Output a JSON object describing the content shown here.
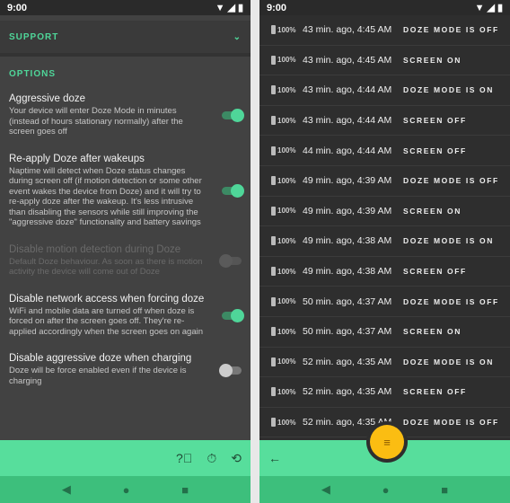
{
  "left": {
    "status_time": "9:00",
    "support_label": "SUPPORT",
    "options_label": "OPTIONS",
    "options": [
      {
        "title": "Aggressive doze",
        "desc": "Your device will enter Doze Mode in minutes (instead of hours stationary normally) after the screen goes off",
        "enabled": true,
        "disabled": false
      },
      {
        "title": "Re-apply Doze after wakeups",
        "desc": "Naptime will detect when Doze status changes during screen off (if motion detection or some other event wakes the device from Doze) and it will try to re-apply doze after the wakeup. It's less intrusive than disabling the sensors while still improving the \"aggressive doze\" functionality and battery savings",
        "enabled": true,
        "disabled": false
      },
      {
        "title": "Disable motion detection during Doze",
        "desc": "Default Doze behaviour. As soon as there is motion activity the device will come out of Doze",
        "enabled": false,
        "disabled": true
      },
      {
        "title": "Disable network access when forcing doze",
        "desc": "WiFi and mobile data are turned off when doze is forced on after the screen goes off. They're re-applied accordingly when the screen goes on again",
        "enabled": true,
        "disabled": false
      },
      {
        "title": "Disable aggressive doze when charging",
        "desc": "Doze will be force enabled even if the device is charging",
        "enabled": false,
        "disabled": false
      }
    ]
  },
  "right": {
    "status_time": "9:00",
    "events": [
      {
        "battery": "100%",
        "time": "43 min. ago, 4:45 AM",
        "event": "DOZE MODE IS OFF"
      },
      {
        "battery": "100%",
        "time": "43 min. ago, 4:45 AM",
        "event": "SCREEN ON"
      },
      {
        "battery": "100%",
        "time": "43 min. ago, 4:44 AM",
        "event": "DOZE MODE IS ON"
      },
      {
        "battery": "100%",
        "time": "43 min. ago, 4:44 AM",
        "event": "SCREEN OFF"
      },
      {
        "battery": "100%",
        "time": "44 min. ago, 4:44 AM",
        "event": "SCREEN OFF"
      },
      {
        "battery": "100%",
        "time": "49 min. ago, 4:39 AM",
        "event": "DOZE MODE IS OFF"
      },
      {
        "battery": "100%",
        "time": "49 min. ago, 4:39 AM",
        "event": "SCREEN ON"
      },
      {
        "battery": "100%",
        "time": "49 min. ago, 4:38 AM",
        "event": "DOZE MODE IS ON"
      },
      {
        "battery": "100%",
        "time": "49 min. ago, 4:38 AM",
        "event": "SCREEN OFF"
      },
      {
        "battery": "100%",
        "time": "50 min. ago, 4:37 AM",
        "event": "DOZE MODE IS OFF"
      },
      {
        "battery": "100%",
        "time": "50 min. ago, 4:37 AM",
        "event": "SCREEN ON"
      },
      {
        "battery": "100%",
        "time": "52 min. ago, 4:35 AM",
        "event": "DOZE MODE IS ON"
      },
      {
        "battery": "100%",
        "time": "52 min. ago, 4:35 AM",
        "event": "SCREEN OFF"
      },
      {
        "battery": "100%",
        "time": "52 min. ago, 4:35 AM",
        "event": "DOZE MODE IS OFF"
      }
    ]
  },
  "colors": {
    "accent": "#4fd699",
    "bar": "#57de9c",
    "fab": "#fbbd12"
  }
}
